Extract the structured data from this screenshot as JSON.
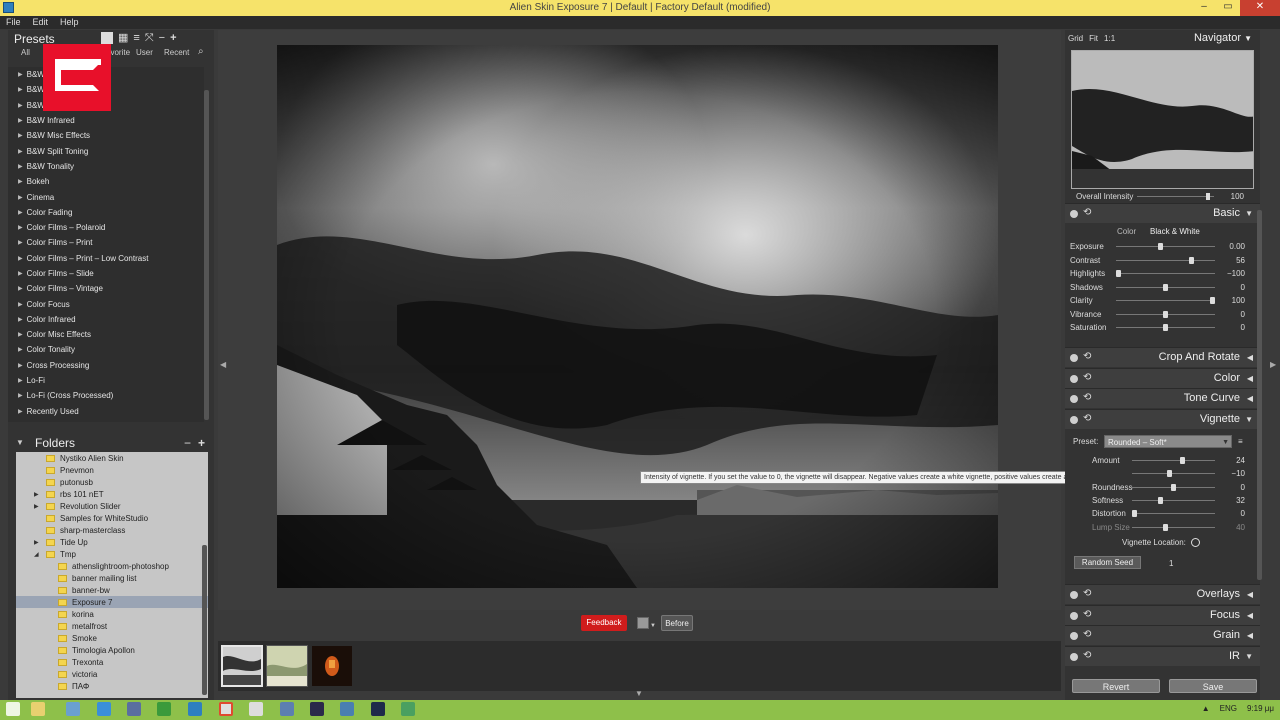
{
  "window": {
    "title": "Alien Skin Exposure 7 | Default | Factory Default (modified)",
    "controls": [
      "–",
      "▭",
      "✕"
    ]
  },
  "menu": [
    "File",
    "Edit",
    "Help"
  ],
  "presets_panel": {
    "title": "Presets",
    "tabs": [
      "All",
      "avorite",
      "User",
      "Recent"
    ],
    "items": [
      "B&W",
      "B&W",
      "B&W",
      "B&W Infrared",
      "B&W Misc Effects",
      "B&W Split Toning",
      "B&W Tonality",
      "Bokeh",
      "Cinema",
      "Color Fading",
      "Color Films – Polaroid",
      "Color Films – Print",
      "Color Films – Print – Low Contrast",
      "Color Films – Slide",
      "Color Films – Vintage",
      "Color Focus",
      "Color Infrared",
      "Color Misc Effects",
      "Color Tonality",
      "Cross Processing",
      "Lo-Fi",
      "Lo-Fi (Cross Processed)",
      "Recently Used"
    ]
  },
  "folders_panel": {
    "title": "Folders",
    "items": [
      {
        "name": "Nystiko Alien Skin",
        "level": 1,
        "expander": ""
      },
      {
        "name": "Pnevmon",
        "level": 1,
        "expander": ""
      },
      {
        "name": "putonusb",
        "level": 1,
        "expander": ""
      },
      {
        "name": "rbs 101 nET",
        "level": 1,
        "expander": "▶"
      },
      {
        "name": "Revolution Slider",
        "level": 1,
        "expander": "▶"
      },
      {
        "name": "Samples for WhiteStudio",
        "level": 1,
        "expander": ""
      },
      {
        "name": "sharp-masterclass",
        "level": 1,
        "expander": ""
      },
      {
        "name": "Tide Up",
        "level": 1,
        "expander": "▶"
      },
      {
        "name": "Tmp",
        "level": 1,
        "expander": "◢"
      },
      {
        "name": "athenslightroom-photoshop",
        "level": 2,
        "expander": ""
      },
      {
        "name": "banner mailing list",
        "level": 2,
        "expander": ""
      },
      {
        "name": "banner-bw",
        "level": 2,
        "expander": ""
      },
      {
        "name": "Exposure 7",
        "level": 2,
        "expander": "",
        "selected": true
      },
      {
        "name": "korina",
        "level": 2,
        "expander": ""
      },
      {
        "name": "metalfrost",
        "level": 2,
        "expander": ""
      },
      {
        "name": "Smoke",
        "level": 2,
        "expander": ""
      },
      {
        "name": "Timologia Apollon",
        "level": 2,
        "expander": ""
      },
      {
        "name": "Trexonta",
        "level": 2,
        "expander": ""
      },
      {
        "name": "victoria",
        "level": 2,
        "expander": ""
      },
      {
        "name": "ΠΑΦ",
        "level": 2,
        "expander": ""
      }
    ]
  },
  "center": {
    "feedback_label": "Feedback",
    "before_label": "Before"
  },
  "navigator": {
    "tabs": [
      "Grid",
      "Fit",
      "1:1"
    ],
    "title": "Navigator",
    "overall_label": "Overall Intensity",
    "overall_value": "100",
    "overall_level": 0.95
  },
  "basic": {
    "name": "Basic",
    "modes": [
      "Color",
      "Black & White"
    ],
    "sliders": [
      {
        "label": "Exposure",
        "value": "0.00",
        "pos": 0.45
      },
      {
        "label": "Contrast",
        "value": "56",
        "pos": 0.78
      },
      {
        "label": "Highlights",
        "value": "−100",
        "pos": 0.0
      },
      {
        "label": "Shadows",
        "value": "0",
        "pos": 0.5
      },
      {
        "label": "Clarity",
        "value": "100",
        "pos": 1.0
      },
      {
        "label": "Vibrance",
        "value": "0",
        "pos": 0.5
      },
      {
        "label": "Saturation",
        "value": "0",
        "pos": 0.5
      }
    ]
  },
  "sections": {
    "crop": "Crop And Rotate",
    "color": "Color",
    "tone_curve": "Tone Curve",
    "vignette": "Vignette",
    "overlays": "Overlays",
    "focus": "Focus",
    "grain": "Grain",
    "ir": "IR"
  },
  "vignette": {
    "preset_label": "Preset:",
    "preset_value": "Rounded – Soft*",
    "sliders": [
      {
        "label": "Amount",
        "value": "24",
        "pos": 0.62,
        "dim": false
      },
      {
        "label": "",
        "value": "−10",
        "pos": 0.45,
        "dim": false
      },
      {
        "label": "Roundness",
        "value": "0",
        "pos": 0.5,
        "dim": false
      },
      {
        "label": "Softness",
        "value": "32",
        "pos": 0.33,
        "dim": false
      },
      {
        "label": "Distortion",
        "value": "0",
        "pos": 0.0,
        "dim": false
      },
      {
        "label": "Lump Size",
        "value": "40",
        "pos": 0.4,
        "dim": true
      }
    ],
    "location_label": "Vignette Location:",
    "random_seed_label": "Random Seed",
    "random_seed_value": "1"
  },
  "tooltip": "Intensity of vignette. If you set the value to 0, the vignette will disappear. Negative values create a white vignette, positive values create a black vignette.",
  "buttons": {
    "revert": "Revert",
    "save": "Save"
  },
  "taskbar": {
    "lang": "ENG",
    "time": "9:19 μμ"
  }
}
